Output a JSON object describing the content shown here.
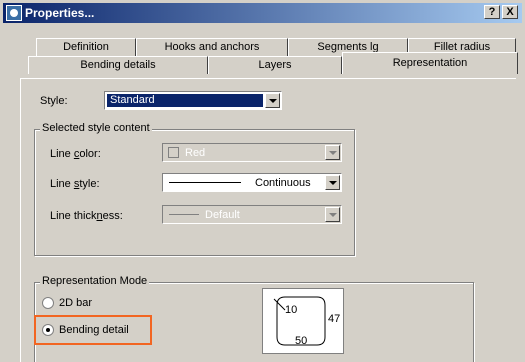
{
  "window": {
    "title": "Properties...",
    "help_btn": "?",
    "close_btn": "X"
  },
  "tabs": {
    "row1": [
      "Definition",
      "Hooks and anchors",
      "Segments lg",
      "Fillet radius"
    ],
    "row2": [
      "Bending details",
      "Layers",
      "Representation"
    ],
    "active": "Representation"
  },
  "style": {
    "label": "Style:",
    "value": "Standard"
  },
  "selected_style_content": {
    "title": "Selected style content",
    "line_color": {
      "label_pre": "Line ",
      "label_key": "c",
      "label_post": "olor:",
      "value": "Red",
      "swatch": "#d4d0c8"
    },
    "line_style": {
      "label_pre": "Line ",
      "label_key": "s",
      "label_post": "tyle:",
      "value": "Continuous"
    },
    "line_thickness": {
      "label_pre": "Line thick",
      "label_key": "n",
      "label_post": "ess:",
      "value": "Default"
    }
  },
  "representation_mode": {
    "title": "Representation Mode",
    "option_2d": "2D bar",
    "option_bending": "Bending detail",
    "selected": "Bending detail",
    "preview": {
      "top": "10",
      "right": "47",
      "bottom": "50"
    }
  },
  "colors": {
    "titlebar_start": "#0a246a",
    "titlebar_end": "#a6caf0",
    "selection": "#0a246a",
    "highlight": "#f26522"
  }
}
